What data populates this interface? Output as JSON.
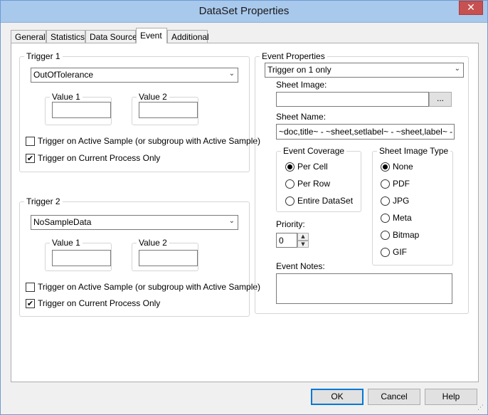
{
  "window": {
    "title": "DataSet Properties",
    "close_glyph": "✕"
  },
  "tabs": [
    "General",
    "Statistics",
    "Data Source",
    "Event",
    "Additional"
  ],
  "trigger1": {
    "label": "Trigger 1",
    "selected": "OutOfTolerance",
    "value1_label": "Value 1",
    "value1": "",
    "value2_label": "Value 2",
    "value2": "",
    "active_sample_label": "Trigger on Active Sample (or subgroup with Active Sample)",
    "active_sample_checked": false,
    "current_process_label": "Trigger on Current Process Only",
    "current_process_checked": true
  },
  "trigger2": {
    "label": "Trigger 2",
    "selected": "NoSampleData",
    "value1_label": "Value 1",
    "value1": "",
    "value2_label": "Value 2",
    "value2": "",
    "active_sample_label": "Trigger on Active Sample (or subgroup with Active Sample)",
    "active_sample_checked": false,
    "current_process_label": "Trigger on Current Process Only",
    "current_process_checked": true
  },
  "event": {
    "label": "Event Properties",
    "mode": "Trigger on 1 only",
    "sheet_image_label": "Sheet Image:",
    "sheet_image": "",
    "browse_label": "...",
    "sheet_name_label": "Sheet Name:",
    "sheet_name": "~doc,title~ - ~sheet,setlabel~ - ~sheet,label~ - ~date",
    "coverage": {
      "label": "Event Coverage",
      "options": [
        "Per Cell",
        "Per Row",
        "Entire DataSet"
      ],
      "selected": "Per Cell"
    },
    "image_type": {
      "label": "Sheet Image Type",
      "options": [
        "None",
        "PDF",
        "JPG",
        "Meta",
        "Bitmap",
        "GIF"
      ],
      "selected": "None"
    },
    "priority_label": "Priority:",
    "priority": "0",
    "notes_label": "Event Notes:",
    "notes": ""
  },
  "buttons": {
    "ok": "OK",
    "cancel": "Cancel",
    "help": "Help"
  },
  "icons": {
    "check": "✔",
    "dropdown": "⌄",
    "spin_up": "▲",
    "spin_down": "▼",
    "grip": "⋰"
  }
}
